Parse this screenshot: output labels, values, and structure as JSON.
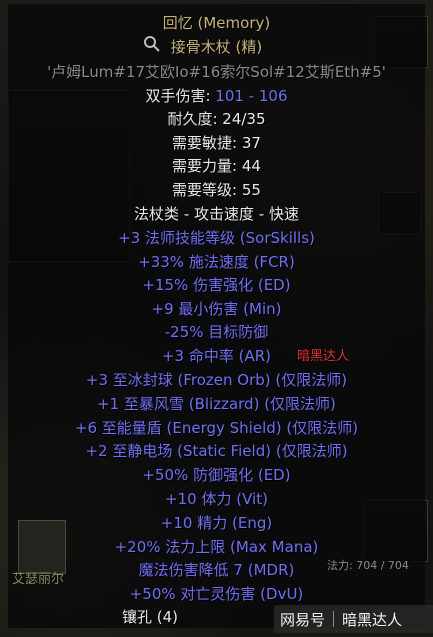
{
  "item": {
    "name": "回忆 (Memory)",
    "base": "接骨木杖 (精)",
    "runes": "'卢姆Lum#17艾欧Io#16索尔Sol#12艾斯Eth#5'",
    "damage_label": "双手伤害: ",
    "damage_value": "101 - 106",
    "durability": "耐久度: 24/35",
    "req_dex": "需要敏捷: 37",
    "req_str": "需要力量: 44",
    "req_level": "需要等级: 55",
    "class_speed": "法杖类 - 攻击速度 - 快速",
    "mods": [
      "+3 法师技能等级 (SorSkills)",
      "+33% 施法速度 (FCR)",
      "+15% 伤害强化 (ED)",
      "+9 最小伤害 (Min)",
      "-25% 目标防御",
      "+3 命中率 (AR)",
      "+3 至冰封球 (Frozen Orb) (仅限法师)",
      "+1 至暴风雪 (Blizzard) (仅限法师)",
      "+6 至能量盾 (Energy Shield) (仅限法师)",
      "+2 至静电场 (Static Field) (仅限法师)",
      "+50% 防御强化 (ED)",
      "+10 体力 (Vit)",
      "+10 精力 (Eng)",
      "+20% 法力上限 (Max Mana)",
      "魔法伤害降低 7 (MDR)",
      "+50% 对亡灵伤害 (DvU)"
    ],
    "sockets": "镶孔 (4)"
  },
  "overlay": {
    "watermark_small": "暗黑达人",
    "character_name": "艾瑟丽尔",
    "mana_readout": "法力: 704 / 704",
    "logo_left": "网易号",
    "logo_right": "暗黑达人"
  },
  "colors": {
    "unique_gold": "#c7b377",
    "magic_blue": "#6f6ff2",
    "text_white": "#e8e8e8",
    "rune_gray": "#8a8a8a"
  }
}
